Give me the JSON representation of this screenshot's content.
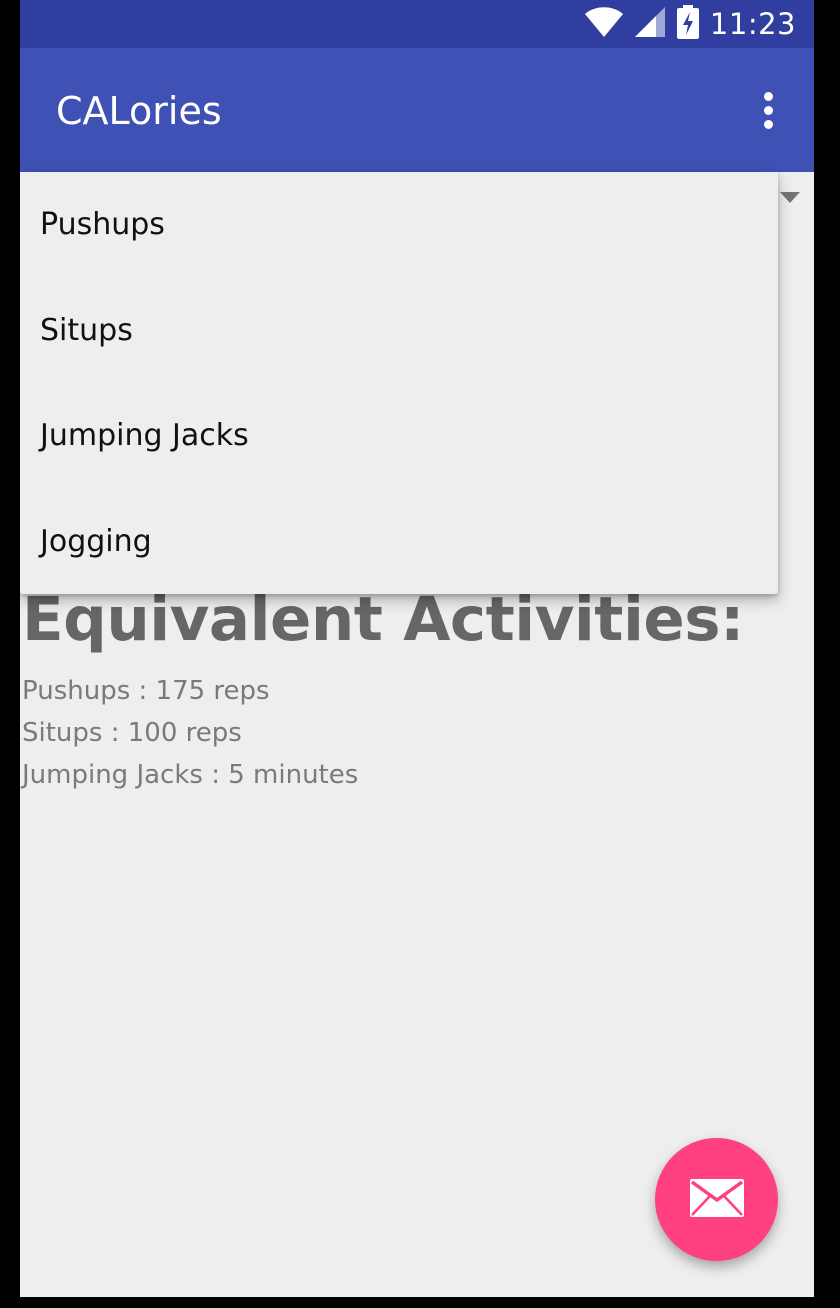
{
  "status_bar": {
    "time": "11:23",
    "icons": [
      "wifi-icon",
      "cellular-signal-icon",
      "battery-charging-icon"
    ]
  },
  "app_bar": {
    "title": "CALories",
    "overflow_icon": "more-vert-icon"
  },
  "dropdown": {
    "items": [
      {
        "label": "Pushups"
      },
      {
        "label": "Situps"
      },
      {
        "label": "Jumping Jacks"
      },
      {
        "label": "Jogging"
      }
    ]
  },
  "main": {
    "heading": "Equivalent Activities:",
    "activities": [
      {
        "text": "Pushups : 175 reps"
      },
      {
        "text": "Situps : 100 reps"
      },
      {
        "text": "Jumping Jacks : 5 minutes"
      }
    ]
  },
  "fab": {
    "icon": "email-icon"
  },
  "colors": {
    "status_bar": "#303f9f",
    "app_bar": "#3f51b5",
    "accent": "#ff4081",
    "background": "#eeeeee"
  }
}
